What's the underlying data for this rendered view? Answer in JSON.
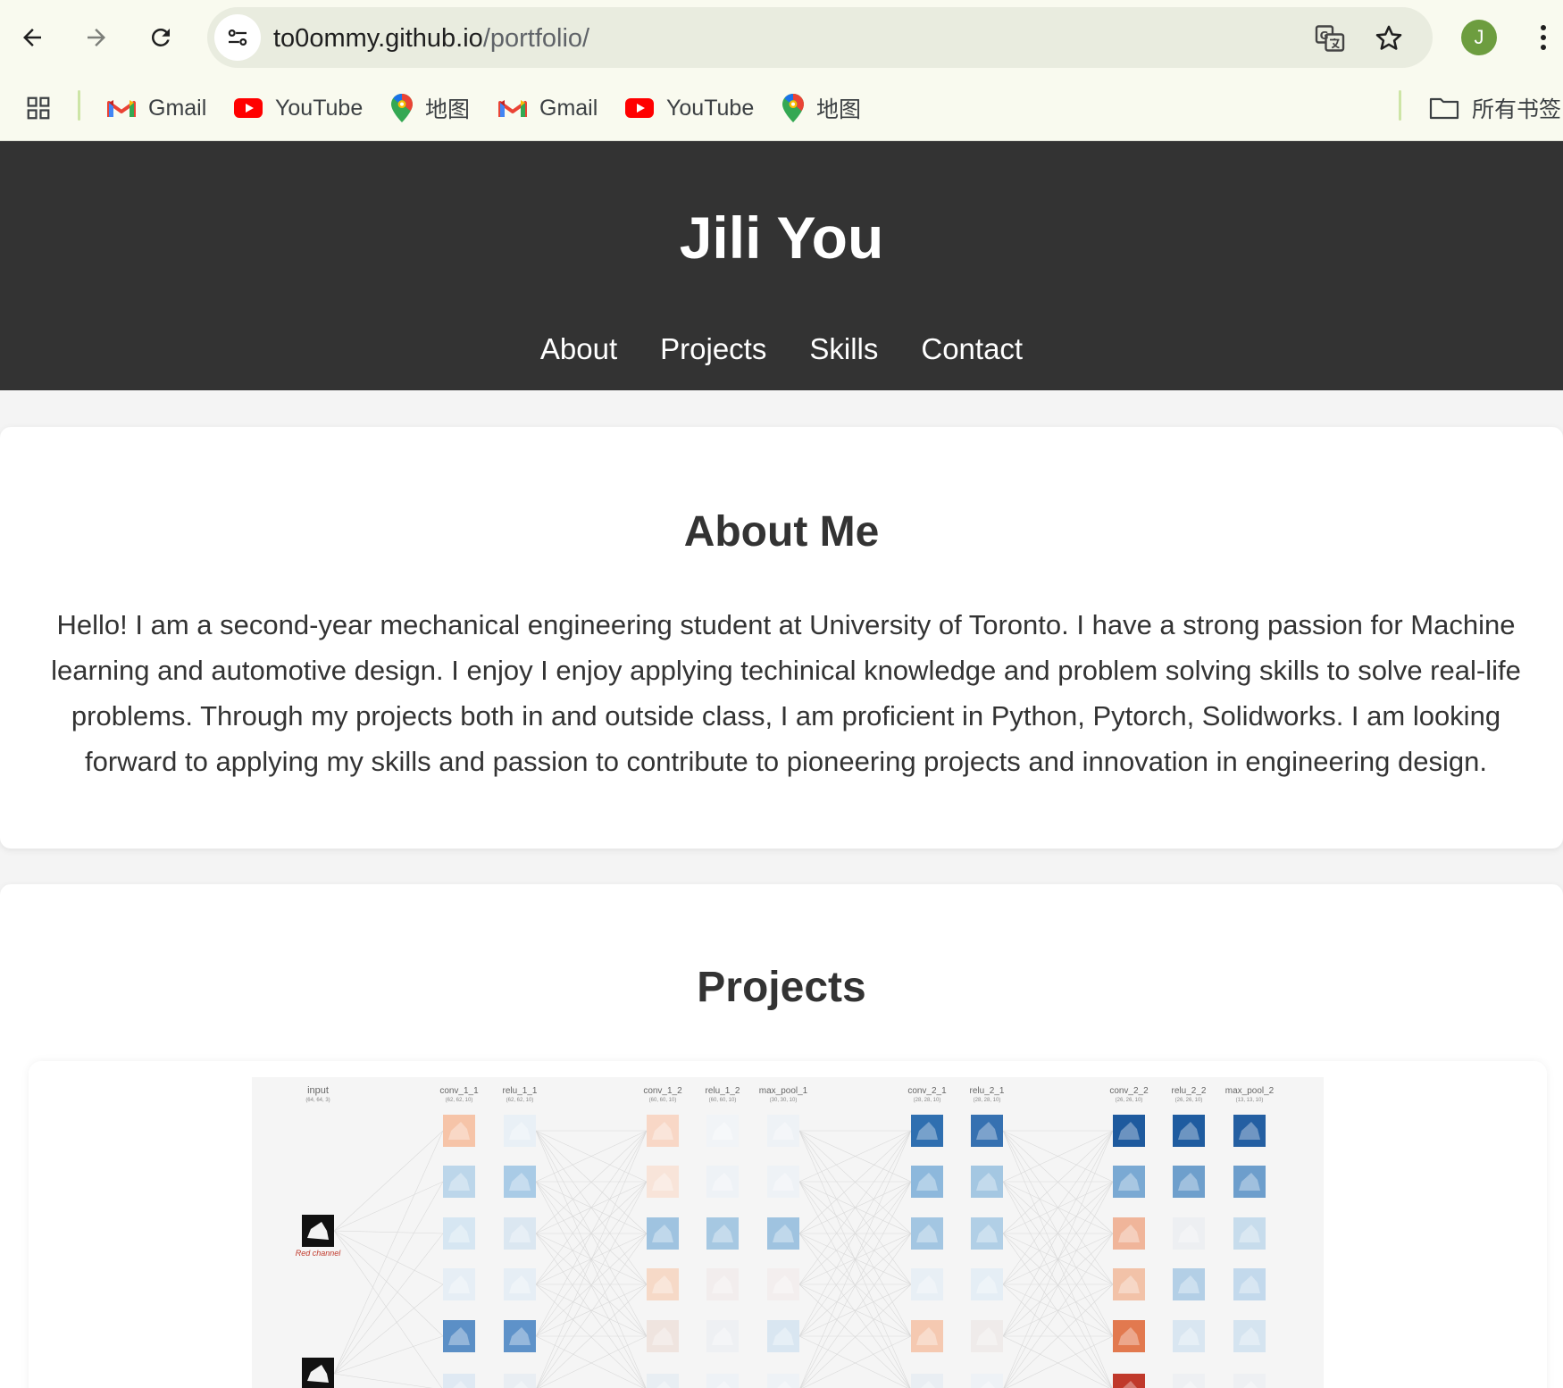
{
  "browser": {
    "url_host": "to0ommy.github.io",
    "url_path": "/portfolio/",
    "profile_initial": "J",
    "bookmarks": [
      {
        "label": "Gmail",
        "icon": "gmail-icon"
      },
      {
        "label": "YouTube",
        "icon": "youtube-icon"
      },
      {
        "label": "地图",
        "icon": "maps-icon"
      },
      {
        "label": "Gmail",
        "icon": "gmail-icon"
      },
      {
        "label": "YouTube",
        "icon": "youtube-icon"
      },
      {
        "label": "地图",
        "icon": "maps-icon"
      }
    ],
    "all_bookmarks_label": "所有书签"
  },
  "site": {
    "title": "Jili You",
    "nav": [
      "About",
      "Projects",
      "Skills",
      "Contact"
    ]
  },
  "about": {
    "heading": "About Me",
    "text": "Hello! I am a second-year mechanical engineering student at University of Toronto. I have a strong passion for Machine learning and automotive design. I enjoy I enjoy applying techinical knowledge and problem solving skills to solve real-life problems. Through my projects both in and outside class, I am proficient in Python, Pytorch, Solidworks. I am looking forward to applying my skills and passion to contribute to pioneering projects and innovation in engineering design."
  },
  "projects": {
    "heading": "Projects",
    "cnn_figure": {
      "input_label": "input",
      "input_shape": "(64, 64, 3)",
      "channel_label": "Red channel",
      "layers": [
        {
          "name": "conv_1_1",
          "shape": "(62, 62, 10)"
        },
        {
          "name": "relu_1_1",
          "shape": "(62, 62, 10)"
        },
        {
          "name": "conv_1_2",
          "shape": "(60, 60, 10)"
        },
        {
          "name": "relu_1_2",
          "shape": "(60, 60, 10)"
        },
        {
          "name": "max_pool_1",
          "shape": "(30, 30, 10)"
        },
        {
          "name": "conv_2_1",
          "shape": "(28, 28, 10)"
        },
        {
          "name": "relu_2_1",
          "shape": "(28, 28, 10)"
        },
        {
          "name": "conv_2_2",
          "shape": "(26, 26, 10)"
        },
        {
          "name": "relu_2_2",
          "shape": "(26, 26, 10)"
        },
        {
          "name": "max_pool_2",
          "shape": "(13, 13, 10)"
        }
      ],
      "tile_colors": [
        [
          "#f6c4a8",
          "#bcd6ea",
          "#d6e6f2",
          "#e6eef5",
          "#5b8fc6",
          "#dfe9f3"
        ],
        [
          "#e9f0f6",
          "#a9cbe6",
          "#dbe7f1",
          "#e6eef5",
          "#5e92c9",
          "#e9eef3"
        ],
        [
          "#f8d7c6",
          "#f8e4d9",
          "#9fc3e0",
          "#f6d9c7",
          "#efe4df",
          "#e8eef3"
        ],
        [
          "#f1f4f7",
          "#eef2f6",
          "#a6c8e2",
          "#f2eded",
          "#eef0f3",
          "#eef2f6"
        ],
        [
          "#eef2f6",
          "#eef2f6",
          "#9fc3e0",
          "#f3eeee",
          "#d9e6f1",
          "#eef2f6"
        ],
        [
          "#2f6fb0",
          "#8db8dc",
          "#a3c6e2",
          "#e8eff5",
          "#f5c9b1",
          "#e9eef3"
        ],
        [
          "#3671b1",
          "#a4c7e2",
          "#b1cfe6",
          "#e5eef5",
          "#efebea",
          "#eef2f6"
        ],
        [
          "#1e5a9e",
          "#7aa9d3",
          "#f0b59a",
          "#f2c2a8",
          "#e2794f",
          "#c0392b"
        ],
        [
          "#1f5ca0",
          "#6e9fcc",
          "#edeff2",
          "#b3cfe6",
          "#d9e6f1",
          "#eef0f3"
        ],
        [
          "#245fa2",
          "#6d9ecc",
          "#c7dcec",
          "#c3d9ec",
          "#d5e4f0",
          "#eef0f3"
        ]
      ]
    }
  }
}
